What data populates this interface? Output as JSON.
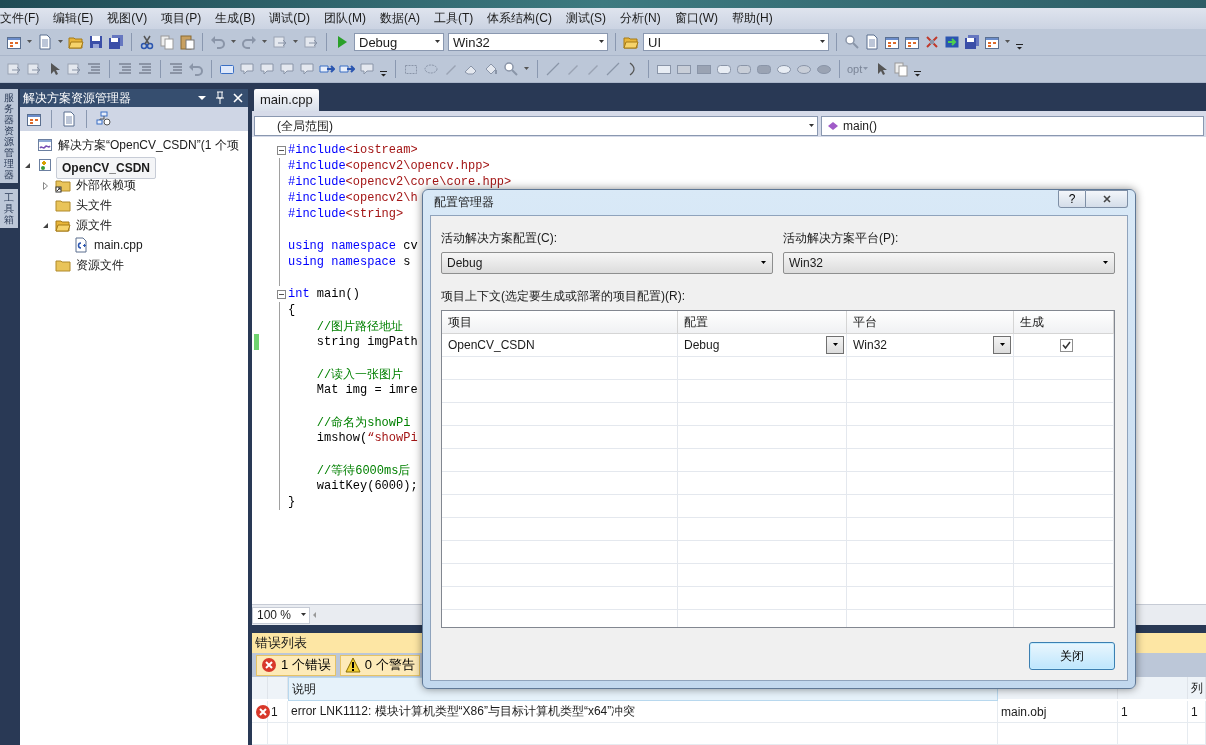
{
  "menu": [
    "文件(F)",
    "编辑(E)",
    "视图(V)",
    "项目(P)",
    "生成(B)",
    "调试(D)",
    "团队(M)",
    "数据(A)",
    "工具(T)",
    "体系结构(C)",
    "测试(S)",
    "分析(N)",
    "窗口(W)",
    "帮助(H)"
  ],
  "toolbar": {
    "configuration": "Debug",
    "platform": "Win32",
    "project": "UI",
    "option": "opt"
  },
  "side_tabs": [
    {
      "label": "服务器资源管理器"
    },
    {
      "label": "工具箱"
    }
  ],
  "solution_explorer": {
    "title": "解决方案资源管理器",
    "tree": [
      {
        "label": "解决方案“OpenCV_CSDN”(1 个项",
        "kind": "solution",
        "selected": false
      },
      {
        "label": "OpenCV_CSDN",
        "kind": "project",
        "selected": true,
        "expanded": true,
        "children": [
          {
            "label": "外部依赖项",
            "kind": "link-folder",
            "selected": false,
            "expanded": false
          },
          {
            "label": "头文件",
            "kind": "folder",
            "selected": false
          },
          {
            "label": "源文件",
            "kind": "open-folder",
            "selected": false,
            "expanded": true,
            "children": [
              {
                "label": "main.cpp",
                "kind": "cpp",
                "selected": false
              }
            ]
          },
          {
            "label": "资源文件",
            "kind": "folder",
            "selected": false
          }
        ]
      }
    ]
  },
  "editor": {
    "tab": "main.cpp",
    "scope": "(全局范围)",
    "member": "main()",
    "zoom": "100 %",
    "lines": [
      {
        "fold": true,
        "segments": [
          {
            "kind": "keyword",
            "text": "#include"
          },
          {
            "kind": "string",
            "text": "<iostream>"
          }
        ]
      },
      {
        "segments": [
          {
            "kind": "keyword",
            "text": "#include"
          },
          {
            "kind": "string",
            "text": "<opencv2\\opencv.hpp>"
          }
        ]
      },
      {
        "segments": [
          {
            "kind": "keyword",
            "text": "#include"
          },
          {
            "kind": "string",
            "text": "<opencv2\\core\\core.hpp>"
          }
        ]
      },
      {
        "segments": [
          {
            "kind": "keyword",
            "text": "#include"
          },
          {
            "kind": "string",
            "text": "<opencv2\\h"
          }
        ]
      },
      {
        "blank_after": true,
        "segments": [
          {
            "kind": "keyword",
            "text": "#include"
          },
          {
            "kind": "string",
            "text": "<string>"
          }
        ]
      },
      {
        "segments": [
          {
            "kind": "keyword",
            "text": "using namespace"
          },
          {
            "kind": "plain",
            "text": " cv"
          }
        ]
      },
      {
        "blank_after": true,
        "segments": [
          {
            "kind": "keyword",
            "text": "using namespace"
          },
          {
            "kind": "plain",
            "text": " s"
          }
        ]
      },
      {
        "fold": true,
        "segments": [
          {
            "kind": "keyword",
            "text": "int"
          },
          {
            "kind": "plain",
            "text": " main()"
          }
        ]
      },
      {
        "segments": [
          {
            "kind": "plain",
            "text": "{"
          }
        ]
      },
      {
        "segments": [
          {
            "kind": "comment",
            "text": "    //图片路径地址"
          }
        ]
      },
      {
        "changed": true,
        "blank_after": true,
        "segments": [
          {
            "kind": "plain",
            "text": "    string imgPath"
          }
        ]
      },
      {
        "segments": [
          {
            "kind": "comment",
            "text": "    //读入一张图片"
          }
        ]
      },
      {
        "blank_after": true,
        "segments": [
          {
            "kind": "plain",
            "text": "    Mat img = imre"
          }
        ]
      },
      {
        "segments": [
          {
            "kind": "comment",
            "text": "    //命名为showPi"
          }
        ]
      },
      {
        "blank_after": true,
        "segments": [
          {
            "kind": "plain",
            "text": "    imshow("
          },
          {
            "kind": "string",
            "text": "“showPi"
          }
        ]
      },
      {
        "segments": [
          {
            "kind": "comment",
            "text": "    //等待6000ms后"
          }
        ]
      },
      {
        "segments": [
          {
            "kind": "plain",
            "text": "    waitKey(6000);"
          }
        ]
      },
      {
        "segments": [
          {
            "kind": "plain",
            "text": "}"
          }
        ]
      }
    ]
  },
  "error_list": {
    "title": "错误列表",
    "filters": [
      {
        "kind": "error",
        "label": "1 个错误"
      },
      {
        "kind": "warning",
        "label": "0 个警告"
      }
    ],
    "columns": {
      "description": "说明",
      "column": "列"
    },
    "rows": [
      {
        "kind": "error",
        "index": "1",
        "description": "error LNK1112: 模块计算机类型“X86”与目标计算机类型“x64”冲突",
        "file": "main.obj",
        "line": "1",
        "column": "1"
      }
    ]
  },
  "dialog": {
    "title": "配置管理器",
    "help": "?",
    "config_label": "活动解决方案配置(C):",
    "config_value": "Debug",
    "platform_label": "活动解决方案平台(P):",
    "platform_value": "Win32",
    "context_label": "项目上下文(选定要生成或部署的项目配置)(R):",
    "columns": [
      "项目",
      "配置",
      "平台",
      "生成"
    ],
    "rows": [
      {
        "project": "OpenCV_CSDN",
        "configuration": "Debug",
        "platform": "Win32",
        "build": true
      }
    ],
    "close_button": "关闭"
  }
}
